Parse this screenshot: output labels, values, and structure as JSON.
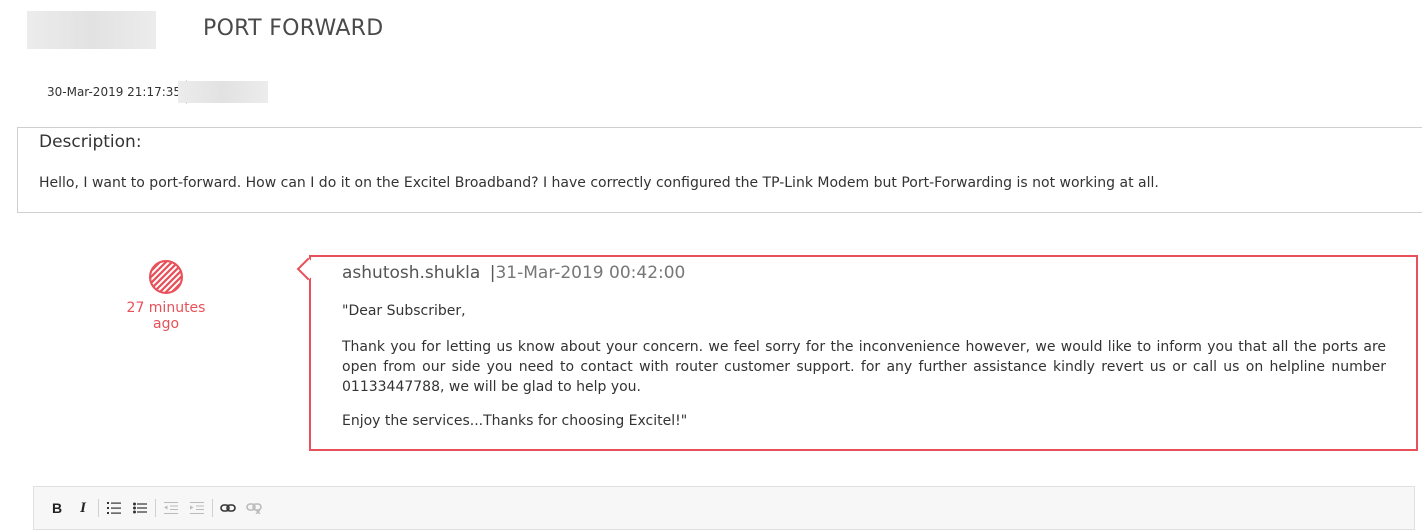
{
  "ticket": {
    "title": "PORT FORWARD",
    "created": "30-Mar-2019 21:17:35"
  },
  "description": {
    "label": "Description:",
    "text": "Hello, I want to port-forward. How can I do it on the Excitel Broadband? I have correctly configured the TP-Link Modem but Port-Forwarding is not working at all."
  },
  "reply": {
    "time_ago": "27 minutes ago",
    "author": "ashutosh.shukla",
    "separator": "|",
    "date": "31-Mar-2019 00:42:00",
    "greeting": "\"Dear Subscriber,",
    "body": "Thank you for letting us know about your concern. we feel sorry for the inconvenience however, we would like to inform you that all the ports are open from our side you need to contact with router customer support. for any further assistance kindly revert us or call us on helpline number 01133447788, we will be glad to help you.",
    "closing": "Enjoy the services...Thanks for choosing Excitel!\"",
    "accent_color": "#e8515a"
  },
  "toolbar": {
    "bold": "B",
    "italic": "I",
    "icons": [
      "bold-icon",
      "italic-icon",
      "numbered-list-icon",
      "bullet-list-icon",
      "outdent-icon",
      "indent-icon",
      "link-icon",
      "unlink-icon"
    ]
  }
}
